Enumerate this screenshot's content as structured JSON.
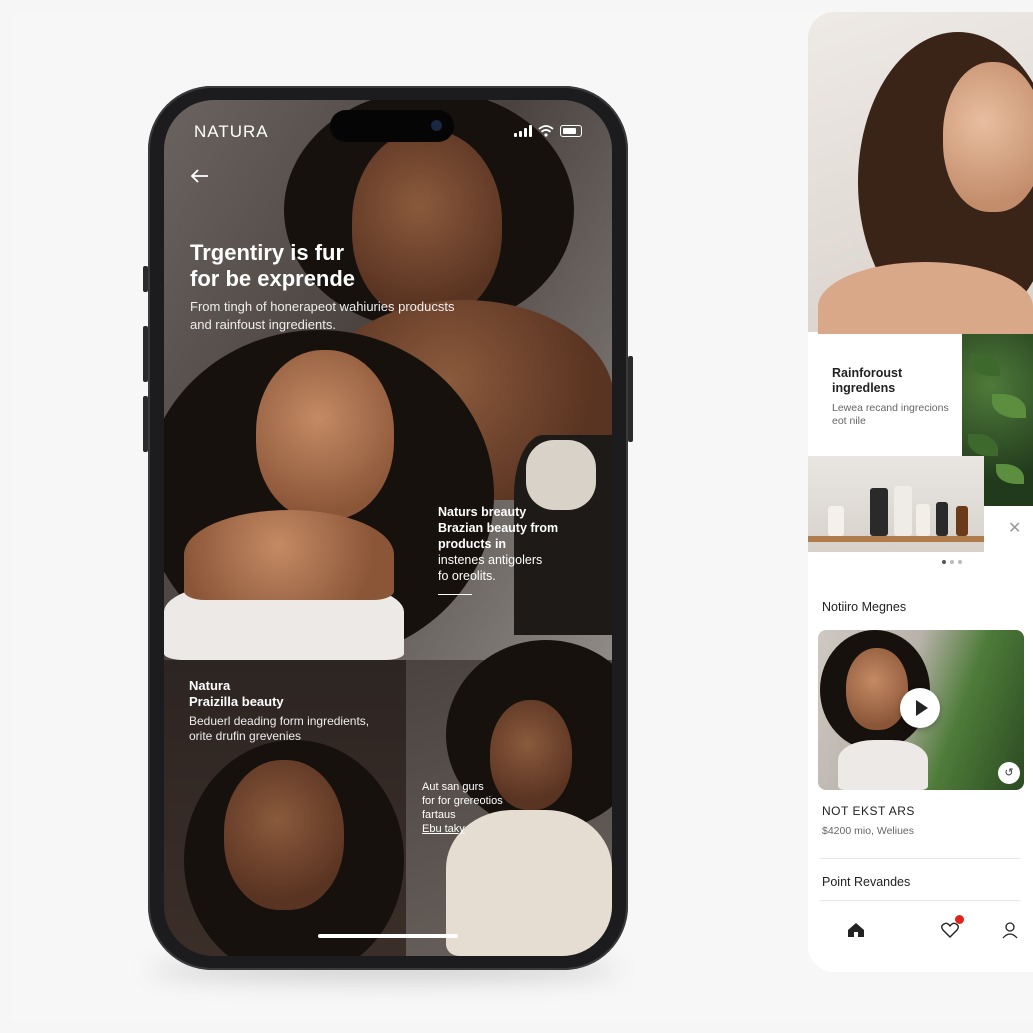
{
  "phone": {
    "brand": "NATURA",
    "hero": {
      "title_line1": "Trgentiry is fur",
      "title_line2": "for be exprende",
      "subtitle_line1": "From tingh of honerapeot wahiuries producsts",
      "subtitle_line2": "and rainfoust ingredients."
    },
    "overlay": {
      "title1": "Naturs breauty",
      "title2": "Brazian beauty from",
      "title3": "products in",
      "line4": "instenes antigolers",
      "line5": "fo oreolits."
    },
    "bottom_left": {
      "title1": "Natura",
      "title2": "Praizilla beauty",
      "sub1": "Beduerl deading form ingredients,",
      "sub2": "orite drufin grevenies"
    },
    "bottom_right": {
      "line1": "Aut san gurs",
      "line2": "for for grereotios",
      "line3": "fartaus",
      "link": "Ebu taky"
    }
  },
  "right_app": {
    "feature": {
      "title1": "Rainforoust",
      "title2": "ingredlens",
      "sub1": "Lewea recand ingrecions",
      "sub2": "eot nile"
    },
    "section_video_title": "Notiiro Megnes",
    "video_item": {
      "name": "NOT EKST ARS",
      "price": "$4200 mio, Weliues"
    },
    "section_bottom_title": "Point Revandes",
    "tab_icons": [
      "home-icon",
      "heart-icon",
      "user-icon"
    ],
    "badge_color": "#e2231a"
  }
}
